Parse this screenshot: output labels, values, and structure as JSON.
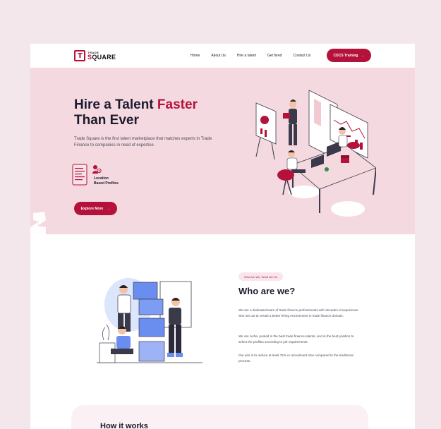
{
  "brand": {
    "mark": "T",
    "small": "TRADE",
    "big_a": "S",
    "big_b": "QUARE",
    "accent": "#b4123a"
  },
  "nav": {
    "links": [
      "Home",
      "About Us",
      "Hire a talent",
      "Get hired",
      "Contact Us"
    ],
    "cta": "CDCS Training",
    "cta_icon": "arrow-right-icon"
  },
  "hero": {
    "title_a": "Hire a Talent ",
    "title_accent": "Faster",
    "title_b": "Than Ever",
    "description": "Trade Square is the first talent marketplace that matches experts in Trade Finance to companies in need of expertise.",
    "feature_line1": "Location",
    "feature_line2": "Based Profiles",
    "button": "Explore More",
    "bg": "#f5d9e0"
  },
  "about": {
    "tag": "Who Are We, What We Do",
    "title": "Who are we?",
    "p1": "We are a dedicated team of trade finance professionals with decades of experience who set out to create a better hiring environment in trade finance domain.",
    "p2": "We are niche, pooled in the best trade finance talents, and in the best position to select the profiles according to job requirements.",
    "p3": "Our aim is to reduce at least 75% in recruitment time compared to the traditional process."
  },
  "how": {
    "title": "How it works"
  }
}
